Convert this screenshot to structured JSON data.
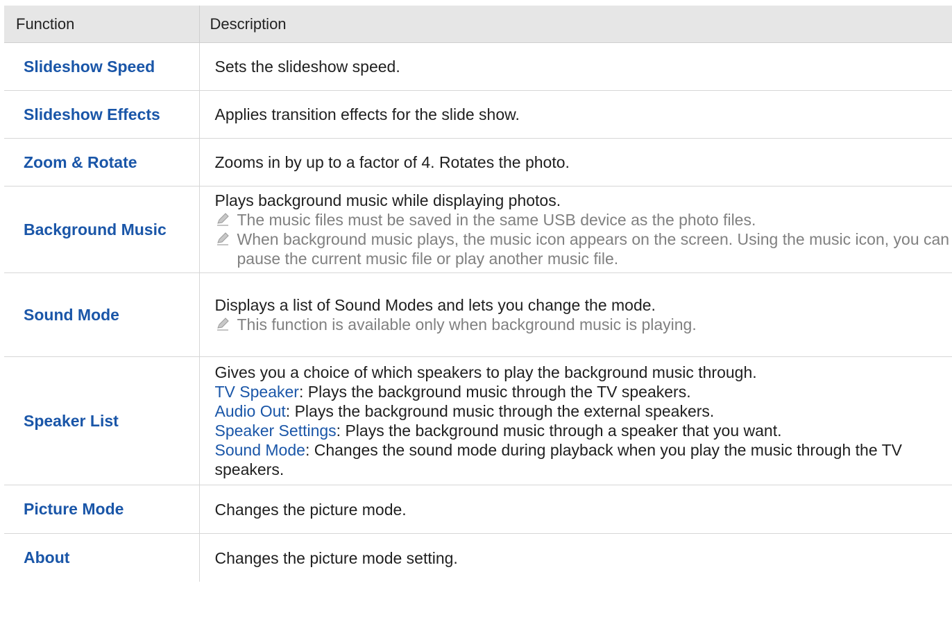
{
  "table": {
    "header": {
      "function": "Function",
      "description": "Description"
    },
    "rows": [
      {
        "function": "Slideshow Speed",
        "description": "Sets the slideshow speed."
      },
      {
        "function": "Slideshow Effects",
        "description": "Applies transition effects for the slide show."
      },
      {
        "function": "Zoom & Rotate",
        "description": "Zooms in by up to a factor of 4. Rotates the photo."
      },
      {
        "function": "Background Music",
        "description": "Plays background music while displaying photos.",
        "notes": [
          "The music files must be saved in the same USB device as the photo files.",
          "When background music plays, the music icon appears on the screen. Using the music icon, you can pause the current music file or play another music file."
        ]
      },
      {
        "function": "Sound Mode",
        "description": "Displays a list of Sound Modes and lets you change the mode.",
        "notes": [
          "This function is available only when background music is playing."
        ]
      },
      {
        "function": "Speaker List",
        "description": "Gives you a choice of which speakers to play the background music through.",
        "options": [
          {
            "name": "TV Speaker",
            "text": ": Plays the background music through the  TV speakers."
          },
          {
            "name": "Audio Out",
            "text": ": Plays the background music through the external speakers."
          },
          {
            "name": "Speaker Settings",
            "text": ": Plays the background music through a speaker that you want."
          },
          {
            "name": "Sound Mode",
            "text": ": Changes the sound mode during playback when you play the music through the TV speakers."
          }
        ]
      },
      {
        "function": "Picture Mode",
        "description": "Changes the picture mode."
      },
      {
        "function": "About",
        "description": "Changes the picture mode setting."
      }
    ]
  },
  "icons": {
    "note": "pencil-note-icon"
  },
  "colors": {
    "function_text": "#1a56a8",
    "note_text": "#808080",
    "header_bg": "#e6e6e6"
  }
}
